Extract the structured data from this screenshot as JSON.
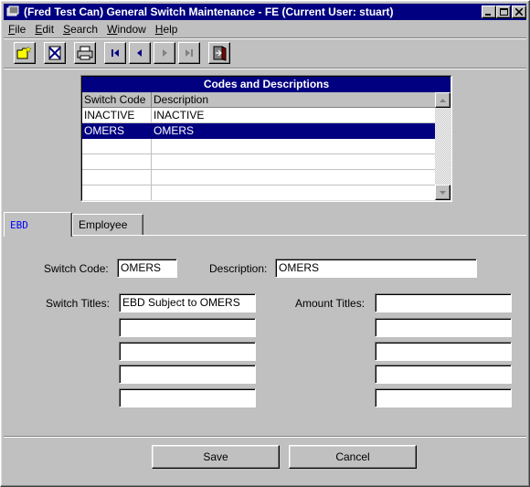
{
  "window": {
    "title": "(Fred Test Can) General Switch Maintenance - FE (Current User: stuart)"
  },
  "menu": [
    {
      "label": "File",
      "mnemonic": "F",
      "rest": "ile"
    },
    {
      "label": "Edit",
      "mnemonic": "E",
      "rest": "dit"
    },
    {
      "label": "Search",
      "mnemonic": "S",
      "rest": "earch"
    },
    {
      "label": "Window",
      "mnemonic": "W",
      "rest": "indow"
    },
    {
      "label": "Help",
      "mnemonic": "H",
      "rest": "elp"
    }
  ],
  "toolbar": {
    "buttons": [
      "new-icon",
      "delete-icon",
      "print-icon",
      "first-record-icon",
      "previous-record-icon",
      "next-record-icon",
      "last-record-icon",
      "exit-icon"
    ]
  },
  "grid": {
    "title": "Codes and Descriptions",
    "columns": [
      "Switch Code",
      "Description"
    ],
    "rows": [
      {
        "code": "INACTIVE",
        "description": "INACTIVE"
      },
      {
        "code": "OMERS",
        "description": "OMERS"
      }
    ],
    "selected_index": 1,
    "empty_rows": 4
  },
  "tabs": [
    {
      "label": "EBD",
      "active": true
    },
    {
      "label": "Employee",
      "active": false
    }
  ],
  "form": {
    "switch_code_label": "Switch Code:",
    "switch_code_value": "OMERS",
    "description_label": "Description:",
    "description_value": "OMERS",
    "switch_titles_label": "Switch Titles:",
    "switch_titles": [
      "EBD Subject to OMERS",
      "",
      "",
      "",
      ""
    ],
    "amount_titles_label": "Amount Titles:",
    "amount_titles": [
      "",
      "",
      "",
      "",
      ""
    ]
  },
  "buttons": {
    "save": "Save",
    "cancel": "Cancel"
  },
  "colors": {
    "titlebar": "#000080",
    "face": "#c0c0c0",
    "selection": "#000080",
    "active_tab_text": "#0000ff"
  }
}
